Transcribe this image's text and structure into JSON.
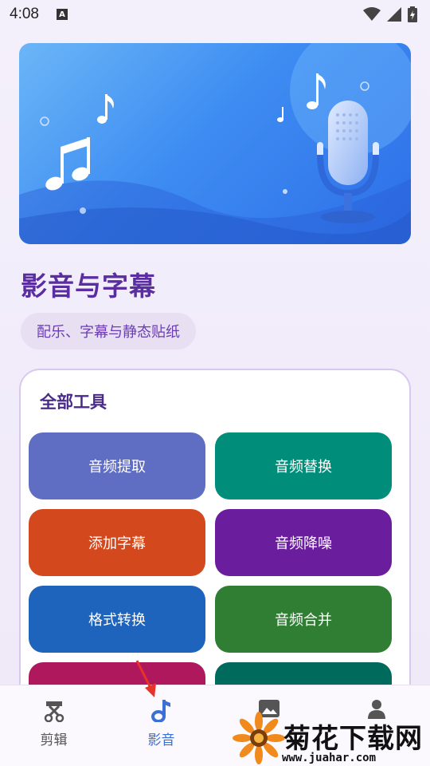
{
  "status": {
    "time": "4:08",
    "notification_icon": "A"
  },
  "page": {
    "title": "影音与字幕",
    "subtitle": "配乐、字幕与静态贴纸"
  },
  "tools": {
    "title": "全部工具",
    "items": [
      {
        "label": "音频提取",
        "color": "#5f6dc3"
      },
      {
        "label": "音频替换",
        "color": "#008e7a"
      },
      {
        "label": "添加字幕",
        "color": "#d4481e"
      },
      {
        "label": "音频降噪",
        "color": "#6a1e9e"
      },
      {
        "label": "格式转换",
        "color": "#1e63bc"
      },
      {
        "label": "音频合并",
        "color": "#2f7e34"
      },
      {
        "label": "",
        "color": "#b0185e"
      },
      {
        "label": "",
        "color": "#006b5c"
      }
    ]
  },
  "nav": {
    "items": [
      {
        "label": "剪辑",
        "icon": "scissors-icon"
      },
      {
        "label": "影音",
        "icon": "music-note-icon",
        "active": true
      },
      {
        "label": "",
        "icon": "gallery-icon"
      },
      {
        "label": "",
        "icon": "profile-icon"
      }
    ]
  },
  "watermark": {
    "title": "菊花下载网",
    "url": "www.juahar.com"
  },
  "colors": {
    "accent": "#5a2ea0",
    "nav_active": "#3b6fd8"
  }
}
